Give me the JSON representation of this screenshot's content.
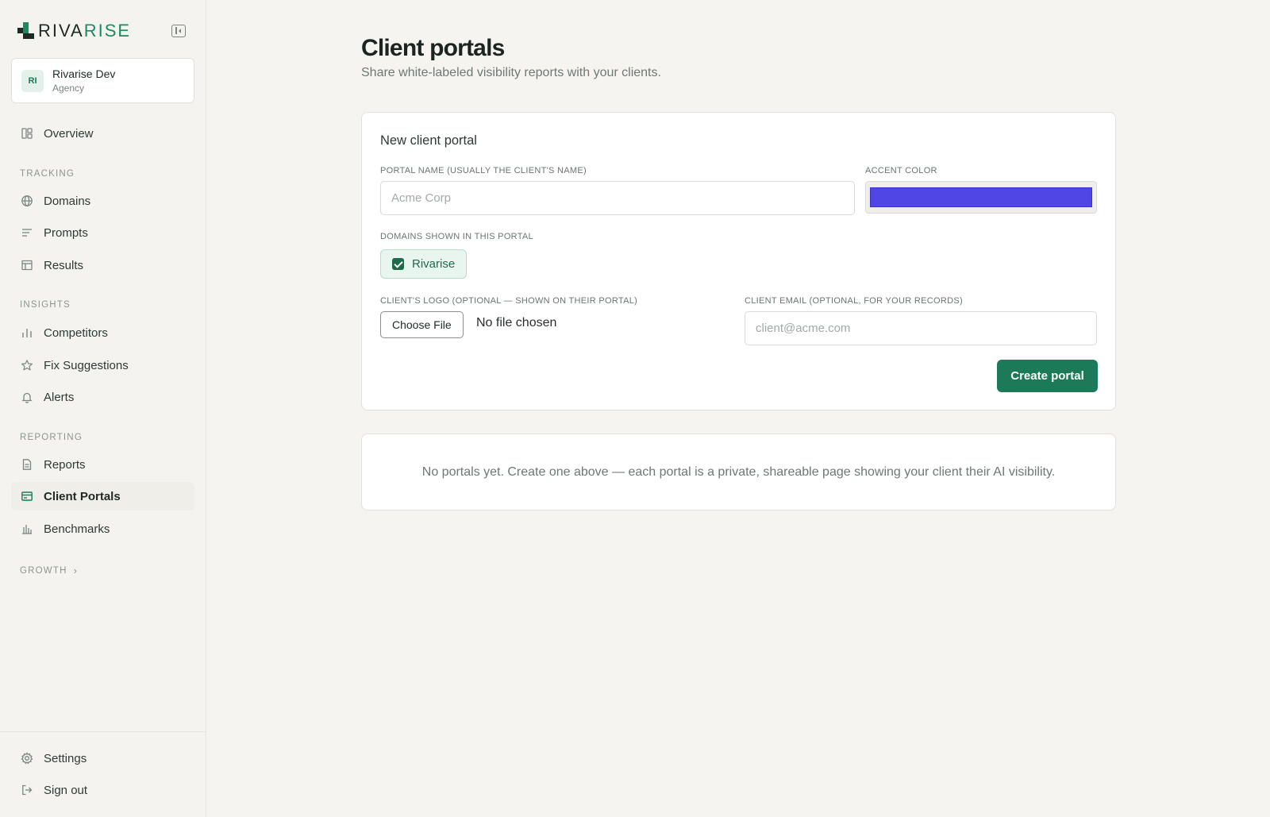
{
  "brand": {
    "word_start": "RIVA",
    "word_accent": "RISE",
    "accent_color": "#1a8a62"
  },
  "workspace": {
    "initials": "RI",
    "name": "Rivarise Dev",
    "type": "Agency"
  },
  "nav": {
    "overview": "Overview",
    "sections": {
      "tracking": "TRACKING",
      "insights": "INSIGHTS",
      "reporting": "REPORTING",
      "growth": "GROWTH"
    },
    "domains": "Domains",
    "prompts": "Prompts",
    "results": "Results",
    "competitors": "Competitors",
    "fix_suggestions": "Fix Suggestions",
    "alerts": "Alerts",
    "reports": "Reports",
    "client_portals": "Client Portals",
    "benchmarks": "Benchmarks",
    "settings": "Settings",
    "sign_out": "Sign out"
  },
  "page": {
    "title": "Client portals",
    "subtitle": "Share white-labeled visibility reports with your clients."
  },
  "form": {
    "title": "New client portal",
    "portal_name_label": "PORTAL NAME (USUALLY THE CLIENT'S NAME)",
    "portal_name_placeholder": "Acme Corp",
    "portal_name_value": "",
    "accent_color_label": "ACCENT COLOR",
    "accent_color_value": "#4f46e5",
    "domains_label": "DOMAINS SHOWN IN THIS PORTAL",
    "domains": [
      {
        "label": "Rivarise",
        "checked": true
      }
    ],
    "logo_label": "CLIENT'S LOGO (OPTIONAL — SHOWN ON THEIR PORTAL)",
    "choose_file_label": "Choose File",
    "file_status": "No file chosen",
    "email_label": "CLIENT EMAIL (OPTIONAL, FOR YOUR RECORDS)",
    "email_placeholder": "client@acme.com",
    "email_value": "",
    "submit_label": "Create portal"
  },
  "empty_state": {
    "text": "No portals yet. Create one above — each portal is a private, shareable page showing your client their AI visibility."
  },
  "colors": {
    "primary": "#1d7a58",
    "background": "#f5f4f0",
    "accent_swatch": "#4f46e5"
  }
}
